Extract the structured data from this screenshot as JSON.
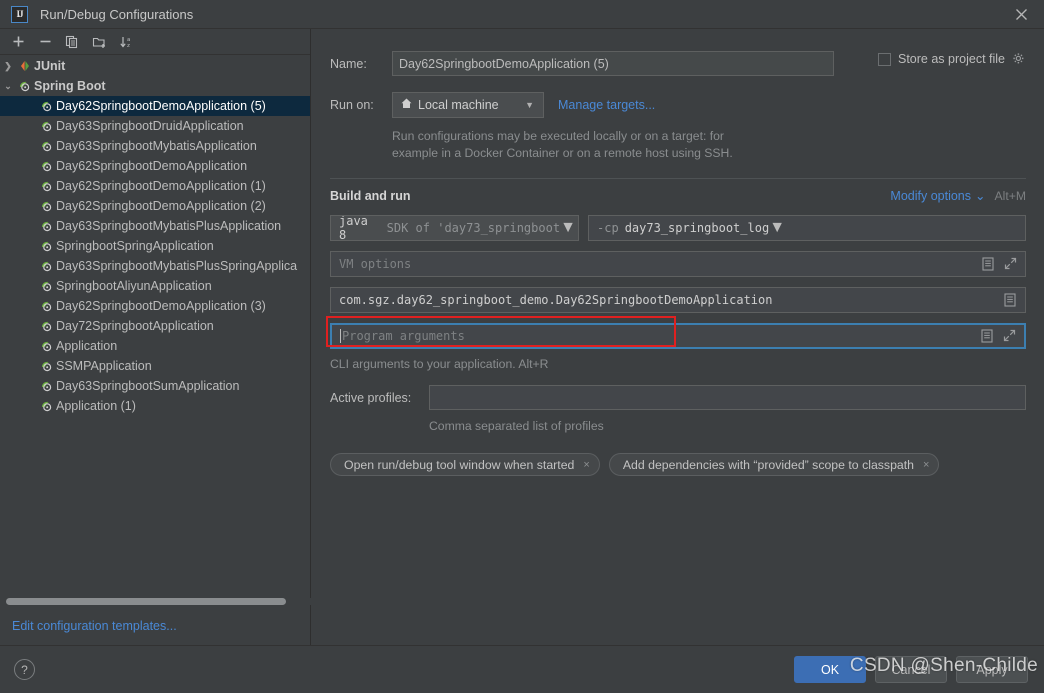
{
  "window": {
    "title": "Run/Debug Configurations",
    "logo_text": "IJ",
    "close_icon": "close-icon"
  },
  "toolbar": {
    "add_label": "+",
    "remove_label": "−",
    "copy_label": "copy-icon",
    "new_folder_label": "new-folder-icon",
    "sort_label": "sort-alphabetically-icon"
  },
  "tree": {
    "groups": [
      {
        "label": "JUnit",
        "expanded": false,
        "arrow": "❯",
        "icon": "junit-icon",
        "items": []
      },
      {
        "label": "Spring Boot",
        "expanded": true,
        "arrow": "⌄",
        "icon": "spring-boot-icon",
        "items": [
          {
            "label": "Day62SpringbootDemoApplication (5)",
            "selected": true
          },
          {
            "label": "Day63SpringbootDruidApplication",
            "selected": false
          },
          {
            "label": "Day63SpringbootMybatisApplication",
            "selected": false
          },
          {
            "label": "Day62SpringbootDemoApplication",
            "selected": false
          },
          {
            "label": "Day62SpringbootDemoApplication (1)",
            "selected": false
          },
          {
            "label": "Day62SpringbootDemoApplication (2)",
            "selected": false
          },
          {
            "label": "Day63SpringbootMybatisPlusApplication",
            "selected": false
          },
          {
            "label": "SpringbootSpringApplication",
            "selected": false
          },
          {
            "label": "Day63SpringbootMybatisPlusSpringApplica",
            "selected": false
          },
          {
            "label": "SpringbootAliyunApplication",
            "selected": false
          },
          {
            "label": "Day62SpringbootDemoApplication (3)",
            "selected": false
          },
          {
            "label": "Day72SpringbootApplication",
            "selected": false
          },
          {
            "label": "Application",
            "selected": false
          },
          {
            "label": "SSMPApplication",
            "selected": false
          },
          {
            "label": "Day63SpringbootSumApplication",
            "selected": false
          },
          {
            "label": "Application (1)",
            "selected": false
          }
        ]
      }
    ],
    "edit_templates_label": "Edit configuration templates..."
  },
  "form": {
    "name_label": "Name:",
    "name_value": "Day62SpringbootDemoApplication (5)",
    "store_as_project_file_label": "Store as project file",
    "store_as_project_file_checked": false,
    "gear_icon": "gear-icon",
    "run_on_label": "Run on:",
    "run_on_value": "Local machine",
    "run_on_icon": "home-icon",
    "manage_targets_label": "Manage targets...",
    "run_on_hint_line1": "Run configurations may be executed locally or on a target: for",
    "run_on_hint_line2": "example in a Docker Container or on a remote host using SSH.",
    "build_and_run_title": "Build and run",
    "modify_options_label": "Modify options",
    "modify_options_caret": "⌄",
    "modify_options_shortcut": "Alt+M",
    "sdk_value": "java 8",
    "sdk_secondary": "SDK of 'day73_springboot_",
    "classpath_flag": "-cp",
    "classpath_value": "day73_springboot_log",
    "vm_options_placeholder": "VM options",
    "vm_options_value": "",
    "main_class_value": "com.sgz.day62_springboot_demo.Day62SpringbootDemoApplication",
    "program_arguments_placeholder": "Program arguments",
    "program_arguments_value": "",
    "program_arguments_hint": "CLI arguments to your application. Alt+R",
    "active_profiles_label": "Active profiles:",
    "active_profiles_value": "",
    "active_profiles_hint": "Comma separated list of profiles",
    "macro_icon": "macro-document-icon",
    "expand_icon": "expand-arrows-icon",
    "chips": [
      {
        "label": "Open run/debug tool window when started",
        "close": "×"
      },
      {
        "label": "Add dependencies with “provided” scope to classpath",
        "close": "×"
      }
    ]
  },
  "footer": {
    "help_label": "?",
    "ok_label": "OK",
    "cancel_label": "Cancel",
    "apply_label": "Apply"
  },
  "watermark": {
    "text": "CSDN @Shen-Childe"
  },
  "colors": {
    "accent_blue": "#4a89d6",
    "ok_button": "#3c6eb4",
    "selection": "#0d293e",
    "highlight_red": "#e02020",
    "focus_border": "#3c7fb1",
    "panel_bg": "#3c3f41"
  }
}
